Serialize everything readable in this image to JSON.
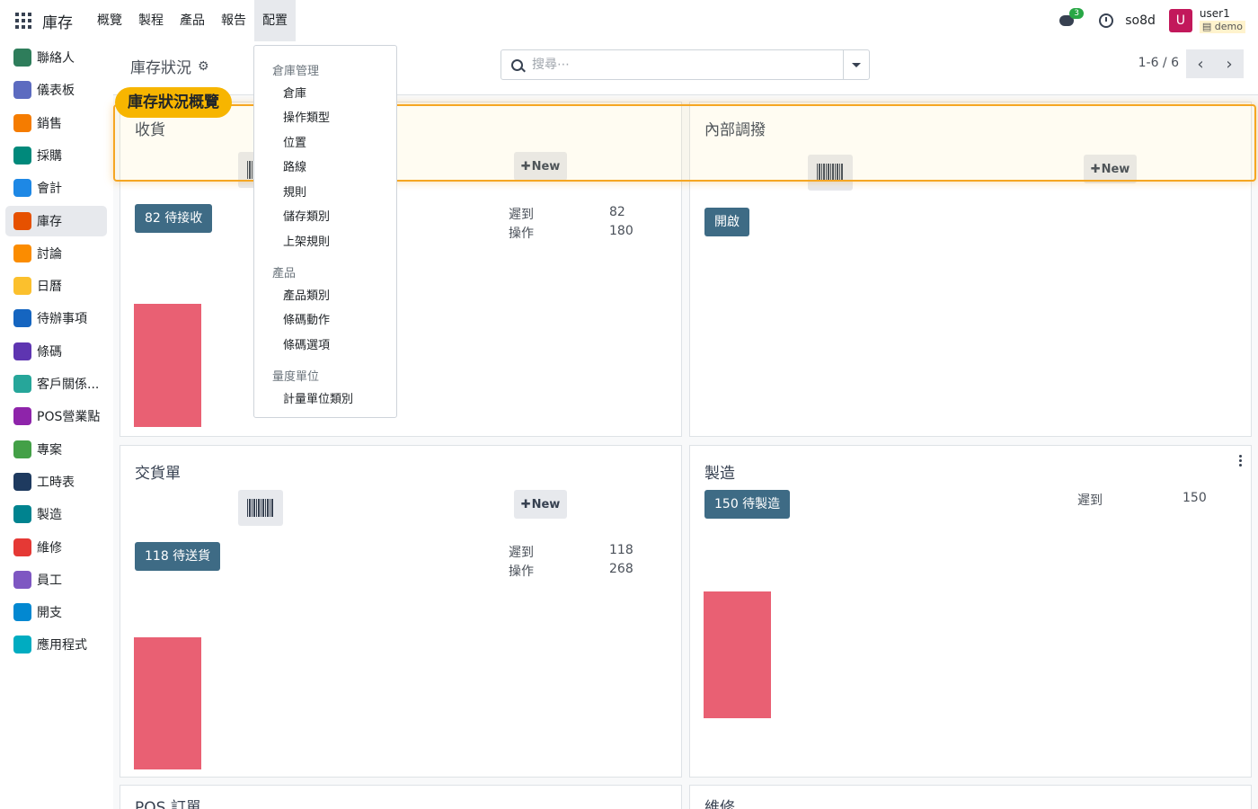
{
  "topbar": {
    "brand": "庫存",
    "menu": [
      "概覽",
      "製程",
      "產品",
      "報告",
      "配置"
    ],
    "active_menu": "配置",
    "chat_badge": "3",
    "db_name": "so8d",
    "avatar_letter": "U",
    "user_name": "user1",
    "user_db": "demo"
  },
  "sidebar": {
    "items": [
      {
        "label": "聯絡人",
        "icon": "contacts-icon",
        "color": "#2e7d5b"
      },
      {
        "label": "儀表板",
        "icon": "dashboard-icon",
        "color": "#5c6bc0"
      },
      {
        "label": "銷售",
        "icon": "sales-icon",
        "color": "#f57c00"
      },
      {
        "label": "採購",
        "icon": "purchase-icon",
        "color": "#00897b"
      },
      {
        "label": "會計",
        "icon": "accounting-icon",
        "color": "#1e88e5"
      },
      {
        "label": "庫存",
        "icon": "inventory-icon",
        "color": "#e65100"
      },
      {
        "label": "討論",
        "icon": "discuss-icon",
        "color": "#fb8c00"
      },
      {
        "label": "日曆",
        "icon": "calendar-icon",
        "color": "#fbc02d"
      },
      {
        "label": "待辦事項",
        "icon": "todo-icon",
        "color": "#1565c0"
      },
      {
        "label": "條碼",
        "icon": "barcode-app-icon",
        "color": "#5e35b1"
      },
      {
        "label": "客戶關係...",
        "icon": "crm-icon",
        "color": "#26a69a"
      },
      {
        "label": "POS營業點",
        "icon": "pos-icon",
        "color": "#8e24aa"
      },
      {
        "label": "專案",
        "icon": "project-icon",
        "color": "#43a047"
      },
      {
        "label": "工時表",
        "icon": "timesheet-icon",
        "color": "#1e3a5f"
      },
      {
        "label": "製造",
        "icon": "manufacturing-icon",
        "color": "#00838f"
      },
      {
        "label": "維修",
        "icon": "repair-icon",
        "color": "#e53935"
      },
      {
        "label": "員工",
        "icon": "employees-icon",
        "color": "#7e57c2"
      },
      {
        "label": "開支",
        "icon": "expenses-icon",
        "color": "#0288d1"
      },
      {
        "label": "應用程式",
        "icon": "apps-store-icon",
        "color": "#00acc1"
      }
    ],
    "active": "庫存"
  },
  "control_panel": {
    "breadcrumb": "庫存狀況",
    "search_placeholder": "搜尋⋯",
    "pager": "1-6 / 6"
  },
  "dropdown": {
    "sections": [
      {
        "header": "倉庫管理",
        "items": [
          "倉庫",
          "操作類型",
          "位置",
          "路線",
          "規則",
          "儲存類別",
          "上架規則"
        ]
      },
      {
        "header": "產品",
        "items": [
          "產品類別",
          "條碼動作",
          "條碼選項"
        ]
      },
      {
        "header": "量度單位",
        "items": [
          "計量單位類別"
        ]
      }
    ]
  },
  "highlight_tag": "庫存狀況概覽",
  "cards": {
    "receipts": {
      "title": "收貨",
      "new_label": "New",
      "action": "82 待接收",
      "late_label": "遲到",
      "late_value": "82",
      "ops_label": "操作",
      "ops_value": "180"
    },
    "internal": {
      "title": "內部調撥",
      "new_label": "New",
      "action": "開啟"
    },
    "delivery": {
      "title": "交貨單",
      "new_label": "New",
      "action": "118 待送貨",
      "late_label": "遲到",
      "late_value": "118",
      "ops_label": "操作",
      "ops_value": "268"
    },
    "manufacturing": {
      "title": "製造",
      "action": "150 待製造",
      "late_label": "遲到",
      "late_value": "150"
    },
    "pos": {
      "title": "POS 訂單"
    },
    "repair": {
      "title": "維修"
    }
  },
  "colors": {
    "accent": "#3e6b85",
    "bar": "#e96073",
    "highlight": "#f7b500"
  }
}
